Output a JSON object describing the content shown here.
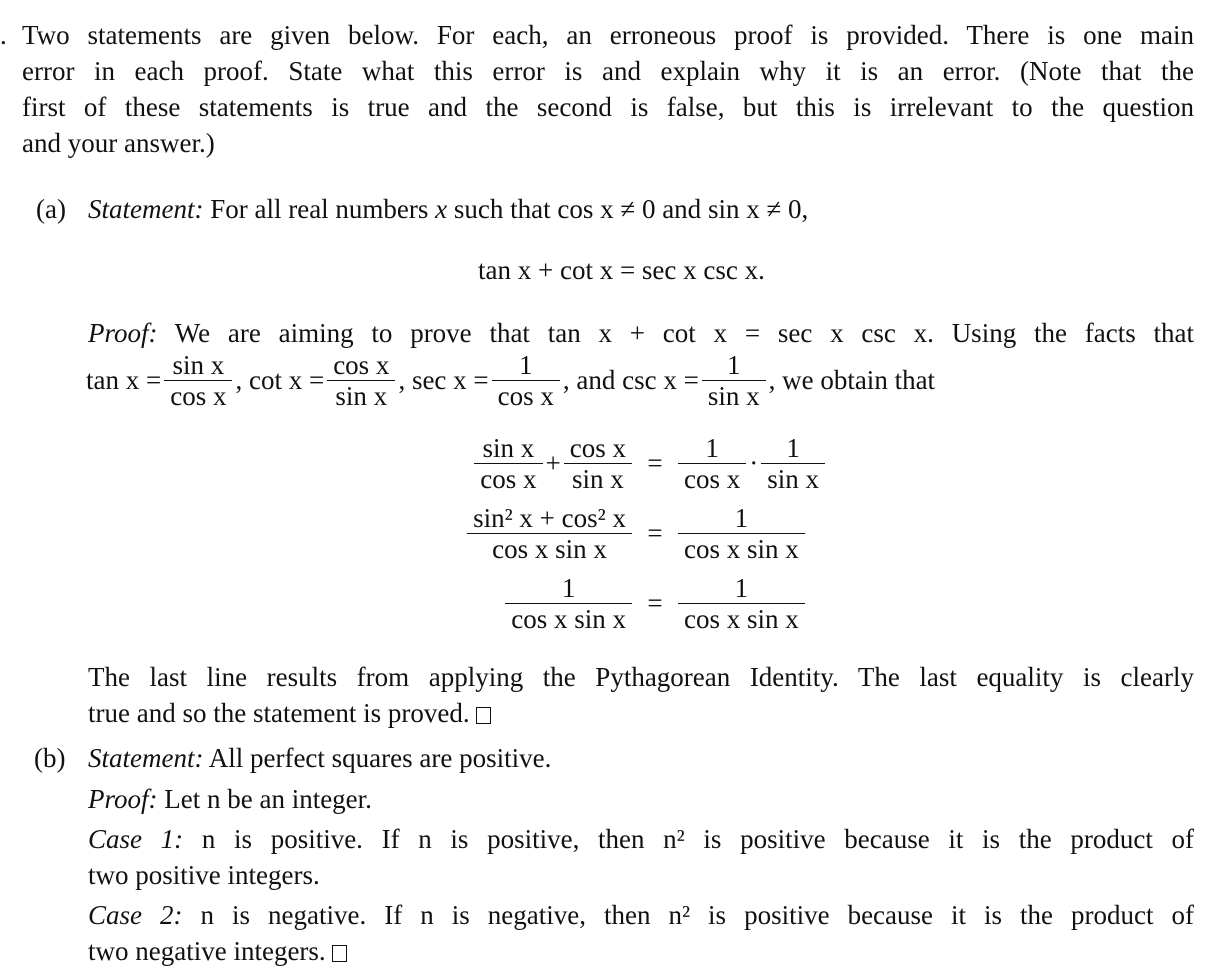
{
  "question": {
    "number_marker": ".",
    "intro_lines": [
      "Two statements are given below. For each, an erroneous proof is provided. There is one main",
      "error in each proof. State what this error is and explain why it is an error. (Note that the",
      "first of these statements is true and the second is false, but this is irrelevant to the question",
      "and your answer.)"
    ]
  },
  "part_a": {
    "label": "(a)",
    "statement_label": "Statement:",
    "statement_text_1": "For all real numbers",
    "var_x": "x",
    "statement_text_2": "such that",
    "cond1": "cos x ≠ 0",
    "and": "and",
    "cond2": "sin x ≠ 0,",
    "display_identity": "tan x + cot x = sec x csc x.",
    "proof_label": "Proof:",
    "proof_line1": "We are aiming to prove that tan x + cot x = sec x csc x. Using the facts that",
    "facts": [
      {
        "lhs": "tan x =",
        "num": "sin x",
        "den": "cos x",
        "sep": ","
      },
      {
        "lhs": "cot x =",
        "num": "cos x",
        "den": "sin x",
        "sep": ","
      },
      {
        "lhs": "sec x =",
        "num": "1",
        "den": "cos x",
        "sep": ","
      },
      {
        "lhs": "and csc x =",
        "num": "1",
        "den": "sin x",
        "sep": ","
      }
    ],
    "facts_tail": "we obtain that",
    "derivation": [
      {
        "lhs_terms": [
          {
            "num": "sin x",
            "den": "cos x"
          },
          {
            "op": "+"
          },
          {
            "num": "cos x",
            "den": "sin x"
          }
        ],
        "eq": "=",
        "rhs_terms": [
          {
            "num": "1",
            "den": "cos x"
          },
          {
            "op": "·"
          },
          {
            "num": "1",
            "den": "sin x"
          }
        ]
      },
      {
        "lhs_terms": [
          {
            "num": "sin² x + cos² x",
            "den": "cos x sin x"
          }
        ],
        "eq": "=",
        "rhs_terms": [
          {
            "num": "1",
            "den": "cos x sin x"
          }
        ]
      },
      {
        "lhs_terms": [
          {
            "num": "1",
            "den": "cos x sin x"
          }
        ],
        "eq": "=",
        "rhs_terms": [
          {
            "num": "1",
            "den": "cos x sin x"
          }
        ]
      }
    ],
    "conclusion_line1": "The last line results from applying the Pythagorean Identity. The last equality is clearly",
    "conclusion_line2": "true and so the statement is proved."
  },
  "part_b": {
    "label": "(b)",
    "statement_label": "Statement:",
    "statement_text": "All perfect squares are positive.",
    "proof_label": "Proof:",
    "proof_text": "Let n be an integer.",
    "case1_label": "Case 1:",
    "case1_line1": "n is positive. If n is positive, then n² is positive because it is the product of",
    "case1_line2": "two positive integers.",
    "case2_label": "Case 2:",
    "case2_line1": "n is negative. If n is negative, then n² is positive because it is the product of",
    "case2_line2": "two negative integers."
  }
}
